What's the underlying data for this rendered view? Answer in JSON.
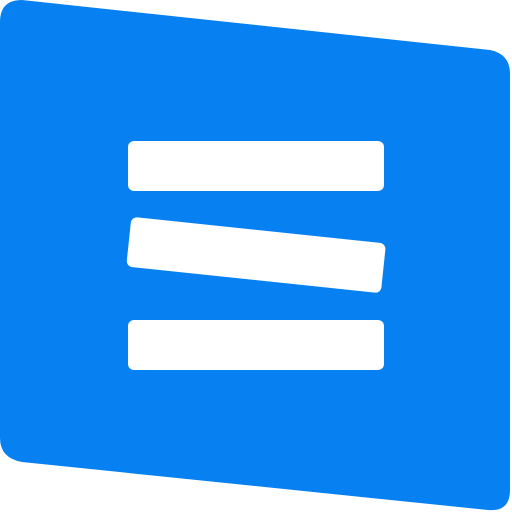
{
  "logo": {
    "icon": "app-logo-icon",
    "colors": {
      "background": "#ffffff",
      "primary": "#0781F2",
      "bars": "#ffffff"
    },
    "bars_count": 3
  }
}
